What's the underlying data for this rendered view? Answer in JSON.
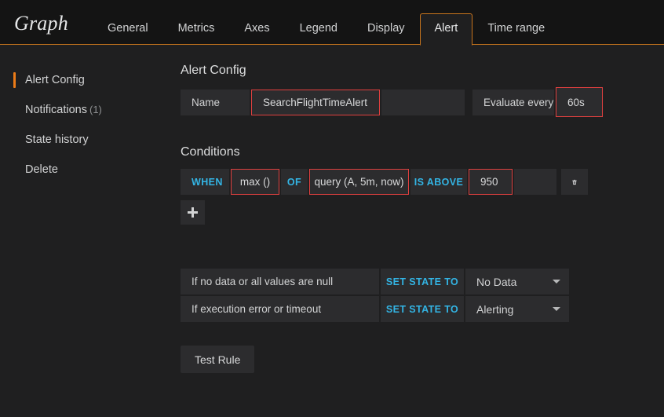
{
  "panel": {
    "title": "Graph"
  },
  "tabs": [
    {
      "label": "General",
      "active": false
    },
    {
      "label": "Metrics",
      "active": false
    },
    {
      "label": "Axes",
      "active": false
    },
    {
      "label": "Legend",
      "active": false
    },
    {
      "label": "Display",
      "active": false
    },
    {
      "label": "Alert",
      "active": true
    },
    {
      "label": "Time range",
      "active": false
    }
  ],
  "sidebar": {
    "items": [
      {
        "label": "Alert Config",
        "count": "",
        "active": true
      },
      {
        "label": "Notifications",
        "count": "(1)",
        "active": false
      },
      {
        "label": "State history",
        "count": "",
        "active": false
      },
      {
        "label": "Delete",
        "count": "",
        "active": false
      }
    ]
  },
  "alert_config": {
    "title": "Alert Config",
    "name_label": "Name",
    "name_value": "SearchFlightTimeAlert",
    "evaluate_label": "Evaluate every",
    "evaluate_value": "60s"
  },
  "conditions": {
    "title": "Conditions",
    "rows": [
      {
        "when_label": "WHEN",
        "reducer": "max ()",
        "of_label": "OF",
        "query": "query (A, 5m, now)",
        "evaluator_label": "IS ABOVE",
        "threshold": "950",
        "delete_icon": "trash-icon"
      }
    ],
    "add_icon": "plus-icon"
  },
  "state_handling": {
    "rows": [
      {
        "description": "If no data or all values are null",
        "action_label": "SET STATE TO",
        "state_value": "No Data",
        "caret_icon": "chevron-down-icon"
      },
      {
        "description": "If execution error or timeout",
        "action_label": "SET STATE TO",
        "state_value": "Alerting",
        "caret_icon": "chevron-down-icon"
      }
    ]
  },
  "actions": {
    "test_rule_label": "Test Rule"
  },
  "colors": {
    "accent_orange": "#eb7b18",
    "tab_border": "#c8751d",
    "link_blue": "#33b5e5",
    "edit_red": "#e0403f",
    "header_bg": "#141414",
    "content_bg": "#1f1f20",
    "segment_bg": "#2c2c2e"
  }
}
